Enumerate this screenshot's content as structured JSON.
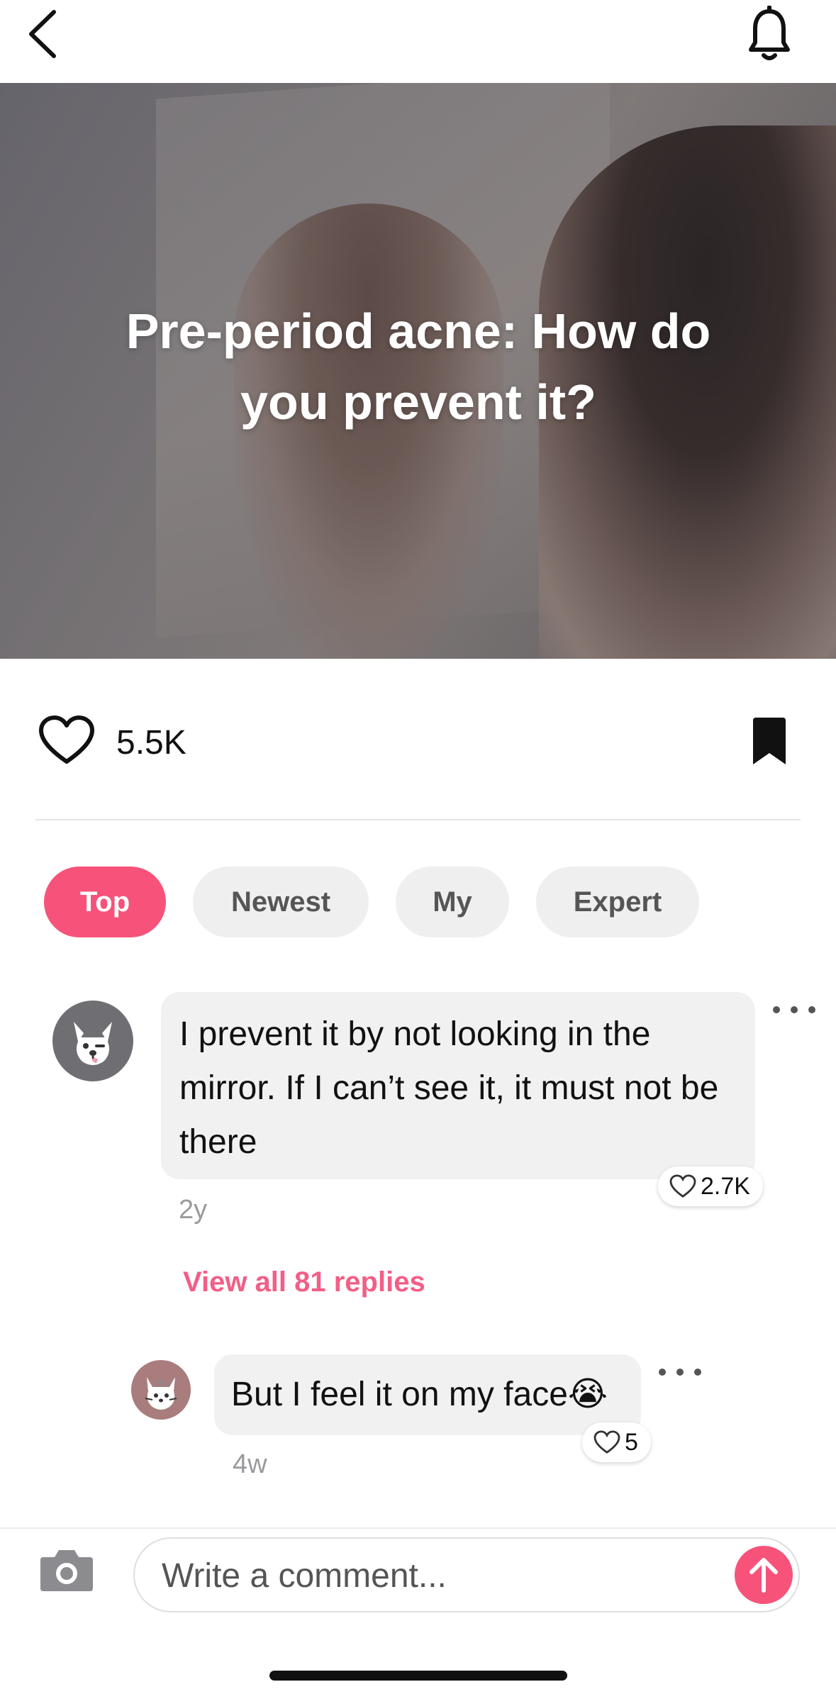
{
  "header": {
    "back_icon": "chevron-left-icon",
    "bell_icon": "bell-icon"
  },
  "hero": {
    "title": "Pre-period acne: How do you prevent it?"
  },
  "engagement": {
    "like_count": "5.5K",
    "heart_icon": "heart-outline-icon",
    "bookmark_icon": "bookmark-filled-icon"
  },
  "tabs": [
    {
      "label": "Top",
      "active": true
    },
    {
      "label": "Newest",
      "active": false
    },
    {
      "label": "My",
      "active": false
    },
    {
      "label": "Expert",
      "active": false
    }
  ],
  "comments": [
    {
      "text": "I prevent it by not looking in the mirror. If I can’t see it, it must not be there",
      "likes": "2.7K",
      "time": "2y",
      "view_replies": "View all 81 replies"
    }
  ],
  "replies": [
    {
      "text": "But I feel it on my face😭",
      "likes": "5",
      "time": "4w"
    }
  ],
  "composer": {
    "placeholder": "Write a comment...",
    "camera_icon": "camera-icon",
    "send_icon": "arrow-up-icon"
  },
  "colors": {
    "accent": "#f7537a",
    "link": "#f25f86",
    "chip": "#efeff0",
    "bubble": "#f1f1f2"
  }
}
